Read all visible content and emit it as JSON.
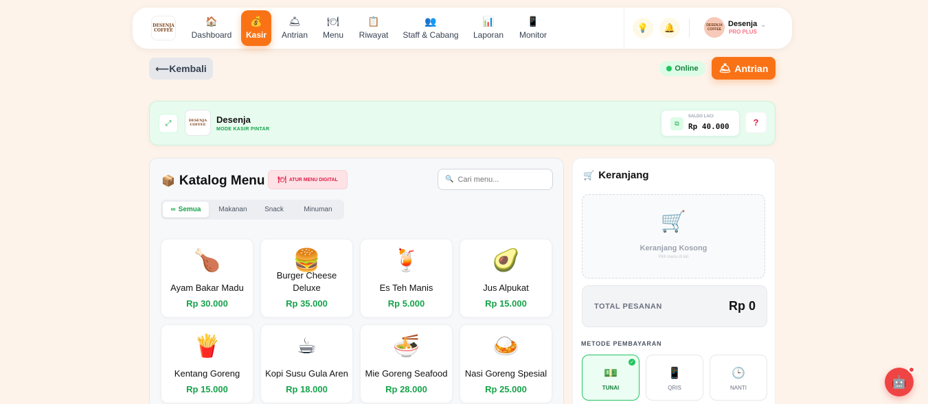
{
  "brand": {
    "logo_text": "DESENJA COFFEE"
  },
  "nav": {
    "items": [
      {
        "label": "Dashboard",
        "icon": "home-icon",
        "glyph": "🏠"
      },
      {
        "label": "Kasir",
        "icon": "cashier-icon",
        "glyph": "💰",
        "active": true
      },
      {
        "label": "Antrian",
        "icon": "bell-queue-icon",
        "glyph": "🛎"
      },
      {
        "label": "Menu",
        "icon": "menu-plate-icon",
        "glyph": "🍽"
      },
      {
        "label": "Riwayat",
        "icon": "receipt-icon",
        "glyph": "📋"
      },
      {
        "label": "Staff & Cabang",
        "icon": "people-icon",
        "glyph": "👥"
      },
      {
        "label": "Laporan",
        "icon": "chart-icon",
        "glyph": "📊"
      },
      {
        "label": "Monitor",
        "icon": "tablet-icon",
        "glyph": "📱"
      }
    ]
  },
  "user": {
    "name": "Desenja",
    "plan": "PRO PLUS",
    "avatar_text": "DESENJA COFFEE"
  },
  "actions": {
    "back_label": "⟵Kembali",
    "status": "Online",
    "antrian_label": "Antrian"
  },
  "store": {
    "name": "Desenja",
    "mode": "MODE KASIR PINTAR",
    "saldo_label": "SALDO LACI",
    "saldo_value": "Rp 40.000",
    "help": "?"
  },
  "catalog": {
    "title": "Katalog Menu",
    "atur_label": "ATUR MENU DIGITAL",
    "search_placeholder": "Cari menu...",
    "tabs": [
      "Semua",
      "Makanan",
      "Snack",
      "Minuman"
    ],
    "active_tab": "Semua",
    "items": [
      {
        "name": "Ayam Bakar Madu",
        "price": "Rp 30.000",
        "emoji": "🍗"
      },
      {
        "name": "Burger Cheese Deluxe",
        "price": "Rp 35.000",
        "emoji": "🍔"
      },
      {
        "name": "Es Teh Manis",
        "price": "Rp 5.000",
        "emoji": "🍹"
      },
      {
        "name": "Jus Alpukat",
        "price": "Rp 15.000",
        "emoji": "🥑"
      },
      {
        "name": "Kentang Goreng",
        "price": "Rp 15.000",
        "emoji": "🍟"
      },
      {
        "name": "Kopi Susu Gula Aren",
        "price": "Rp 18.000",
        "emoji": "☕"
      },
      {
        "name": "Mie Goreng Seafood",
        "price": "Rp 28.000",
        "emoji": "🍜"
      },
      {
        "name": "Nasi Goreng Spesial",
        "price": "Rp 25.000",
        "emoji": "🍛"
      }
    ]
  },
  "cart": {
    "title": "Keranjang",
    "empty_title": "Keranjang Kosong",
    "empty_sub": "Pilih menu di kiri",
    "total_label": "TOTAL PESANAN",
    "total_value": "Rp 0",
    "metode_label": "METODE PEMBAYARAN",
    "methods": [
      {
        "label": "TUNAI",
        "glyph": "💵",
        "icon": "cash-icon",
        "active": true
      },
      {
        "label": "QRIS",
        "glyph": "📱",
        "icon": "qris-icon"
      },
      {
        "label": "NANTI",
        "glyph": "🕒",
        "icon": "clock-icon"
      }
    ]
  },
  "colors": {
    "accent": "#f97316",
    "success": "#16a34a",
    "background": "#fdf3ea"
  }
}
